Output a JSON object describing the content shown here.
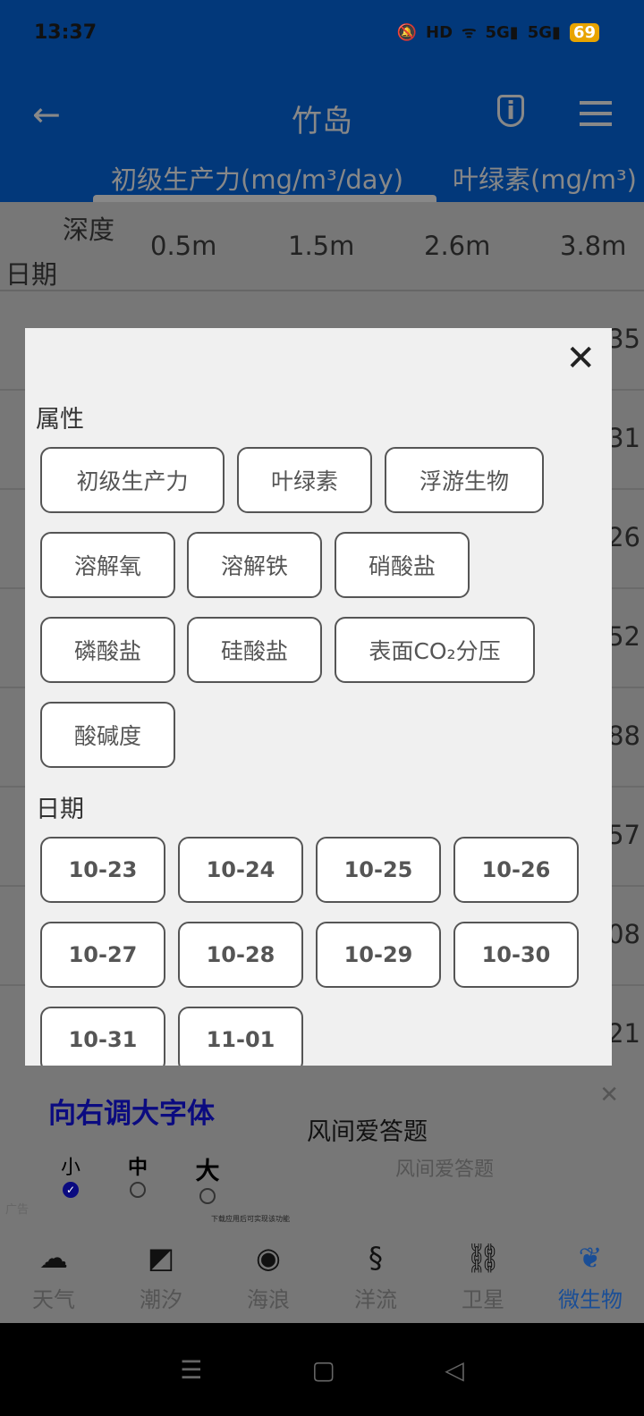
{
  "status_bar": {
    "time": "13:37",
    "icons": [
      "mute-icon",
      "hd-icon",
      "wifi-icon",
      "5g-signal-icon",
      "5g-signal-icon"
    ],
    "battery": "69"
  },
  "app_bar": {
    "title": "竹岛",
    "back_icon": "arrow-left-icon",
    "info_icon": "shield-info-icon",
    "menu_icon": "hamburger-icon"
  },
  "tabs": [
    {
      "label": "初级生产力(mg/m³/day)",
      "active": true
    },
    {
      "label": "叶绿素(mg/m³)"
    }
  ],
  "table": {
    "corner_top": "深度",
    "corner_bottom": "日期",
    "depths": [
      "0.5m",
      "1.5m",
      "2.6m",
      "3.8m"
    ],
    "partial_values": [
      "35",
      "31",
      "26",
      "52",
      "88",
      "57",
      "08",
      "21"
    ]
  },
  "dialog": {
    "attr_title": "属性",
    "attributes": [
      "初级生产力",
      "叶绿素",
      "浮游生物",
      "溶解氧",
      "溶解铁",
      "硝酸盐",
      "磷酸盐",
      "硅酸盐",
      "表面CO₂分压",
      "酸碱度"
    ],
    "date_title": "日期",
    "dates": [
      "10-23",
      "10-24",
      "10-25",
      "10-26",
      "10-27",
      "10-28",
      "10-29",
      "10-30",
      "10-31",
      "11-01"
    ],
    "close_icon": "close-icon"
  },
  "ad": {
    "title": "向右调大字体",
    "options": [
      "小",
      "中",
      "大"
    ],
    "selected": "小",
    "headline": "风间爱答题",
    "sub": "风间爱答题",
    "label": "广告",
    "note": "下载应用后可实现该功能"
  },
  "bottom_nav": [
    {
      "label": "天气",
      "icon": "cloud-icon"
    },
    {
      "label": "潮汐",
      "icon": "tide-wave-icon"
    },
    {
      "label": "海浪",
      "icon": "ocean-wave-icon"
    },
    {
      "label": "洋流",
      "icon": "current-icon"
    },
    {
      "label": "卫星",
      "icon": "satellite-icon"
    },
    {
      "label": "微生物",
      "icon": "microbe-icon",
      "active": true
    }
  ],
  "colors": {
    "accent": "#1a4e96",
    "app_bar": "#02387a",
    "ad_title": "#0b0b80"
  }
}
